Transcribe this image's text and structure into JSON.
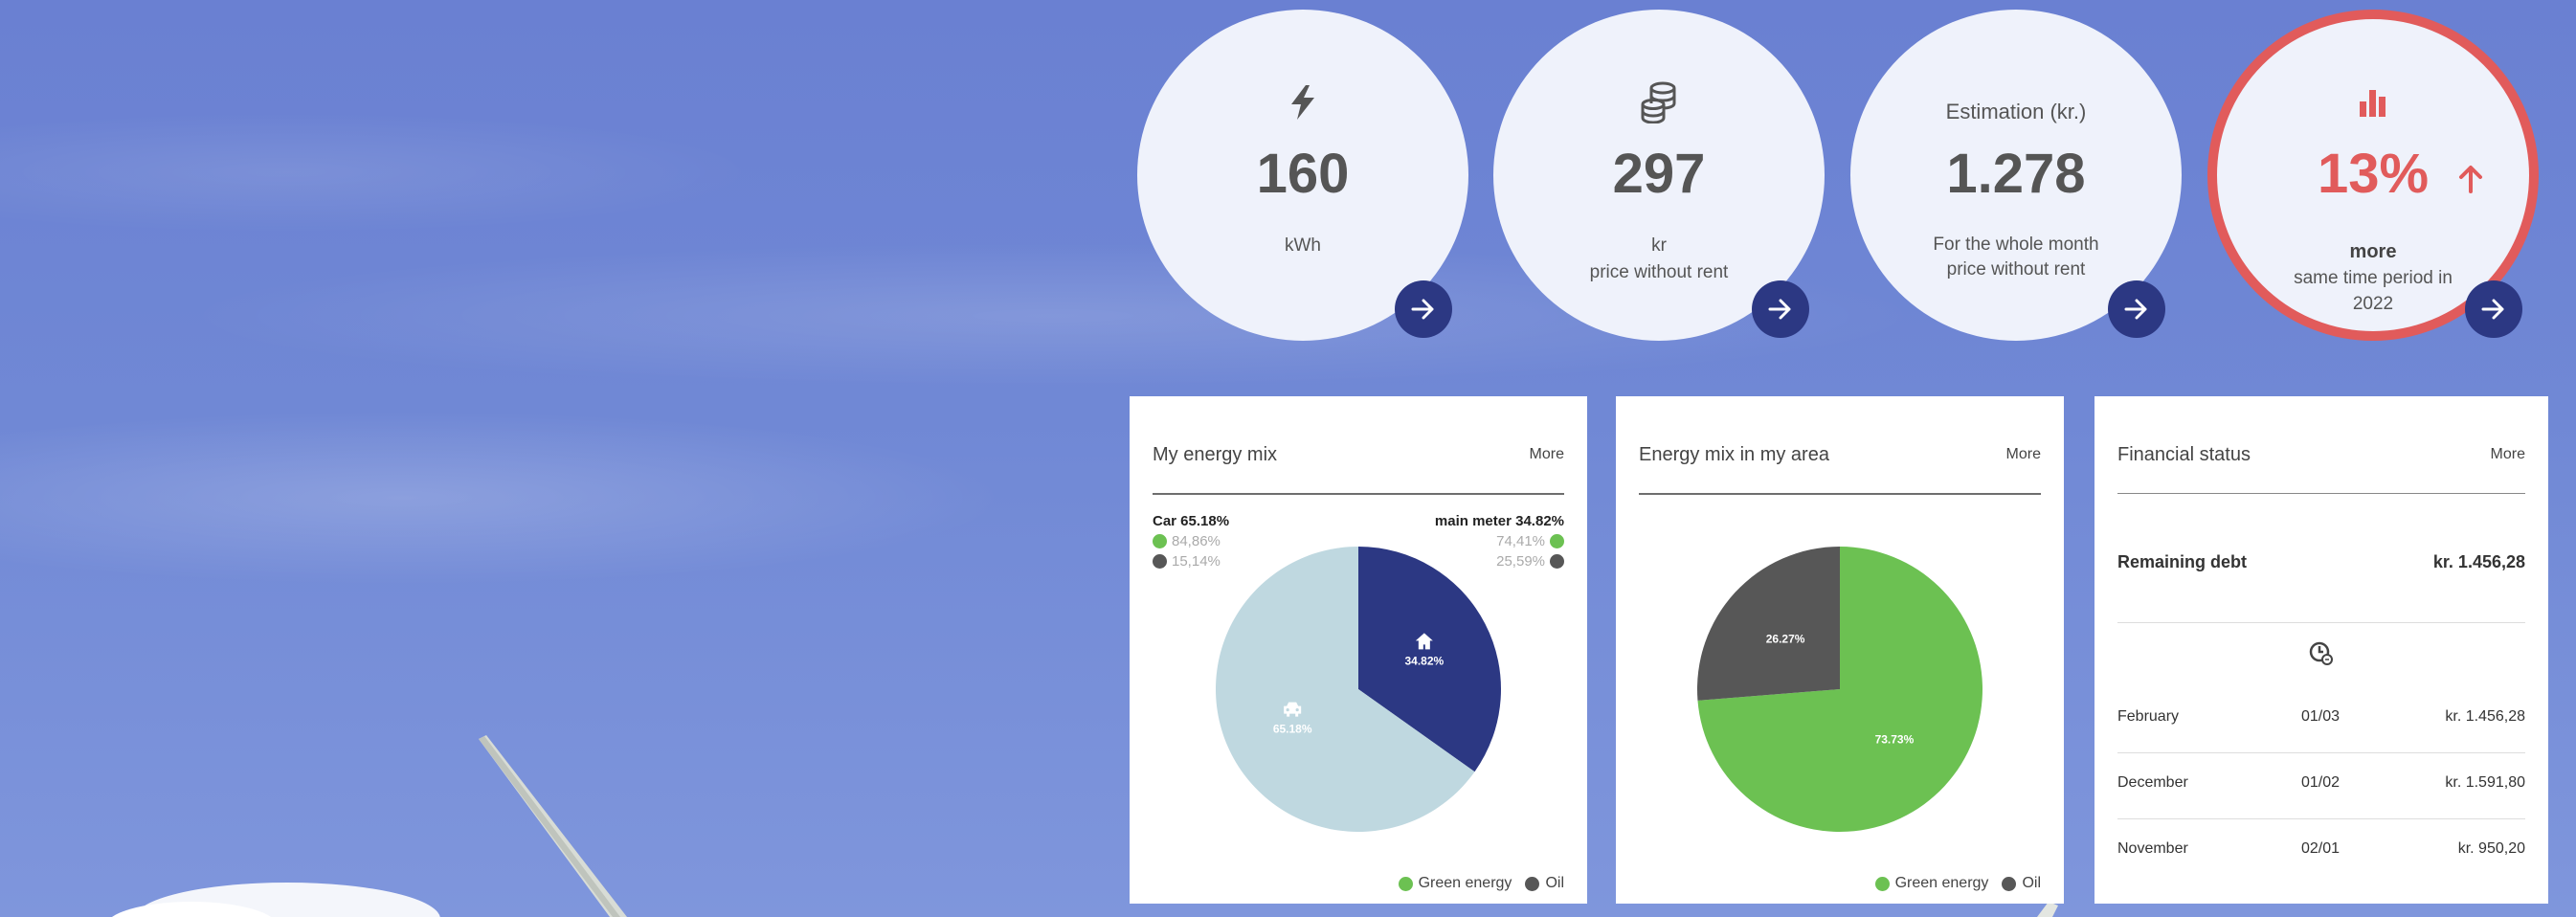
{
  "stats": [
    {
      "icon": "lightning-icon",
      "value": "160",
      "line1": "kWh",
      "line2": ""
    },
    {
      "icon": "coins-icon",
      "value": "297",
      "line1": "kr",
      "line2": "price without rent"
    },
    {
      "top_label": "Estimation (kr.)",
      "value": "1.278",
      "line1": "For the whole month",
      "line2": "price without rent"
    },
    {
      "icon": "bar-chart-icon",
      "value": "13%",
      "trend_icon": "arrow-up-icon",
      "line1": "more",
      "line2": "same time period in",
      "line3": "2022"
    }
  ],
  "colors": {
    "navy": "#2c3883",
    "light_blue": "#bfd8e0",
    "green": "#6cc152",
    "dark_gray": "#575757",
    "red": "#e15b5b",
    "circle_bg": "#eff2fb"
  },
  "my_mix": {
    "title": "My energy mix",
    "more": "More",
    "car_label": "Car 65.18%",
    "car_green": "84,86%",
    "car_oil": "15,14%",
    "meter_label": "main meter 34.82%",
    "meter_green": "74,41%",
    "meter_oil": "25,59%",
    "legend_green": "Green energy",
    "legend_oil": "Oil"
  },
  "area_mix": {
    "title": "Energy mix in my area",
    "more": "More",
    "legend_green": "Green energy",
    "legend_oil": "Oil"
  },
  "chart_data": [
    {
      "type": "pie",
      "categories": [
        "main meter",
        "Car"
      ],
      "values": [
        34.82,
        65.18
      ],
      "data_labels": [
        "34.82%",
        "65.18%"
      ],
      "icons": [
        "home-icon",
        "car-icon"
      ],
      "colors": [
        "#2c3883",
        "#bfd8e0"
      ]
    },
    {
      "type": "pie",
      "categories": [
        "Green energy",
        "Oil"
      ],
      "values": [
        73.73,
        26.27
      ],
      "data_labels": [
        "73.73%",
        "26.27%"
      ],
      "colors": [
        "#6cc152",
        "#575757"
      ]
    }
  ],
  "financial": {
    "title": "Financial status",
    "more": "More",
    "remaining_label": "Remaining debt",
    "remaining_value": "kr. 1.456,28",
    "clock_icon": "clock-icon",
    "rows": [
      {
        "month": "February",
        "date": "01/03",
        "amount": "kr. 1.456,28"
      },
      {
        "month": "December",
        "date": "01/02",
        "amount": "kr. 1.591,80"
      },
      {
        "month": "November",
        "date": "02/01",
        "amount": "kr. 950,20"
      }
    ]
  }
}
